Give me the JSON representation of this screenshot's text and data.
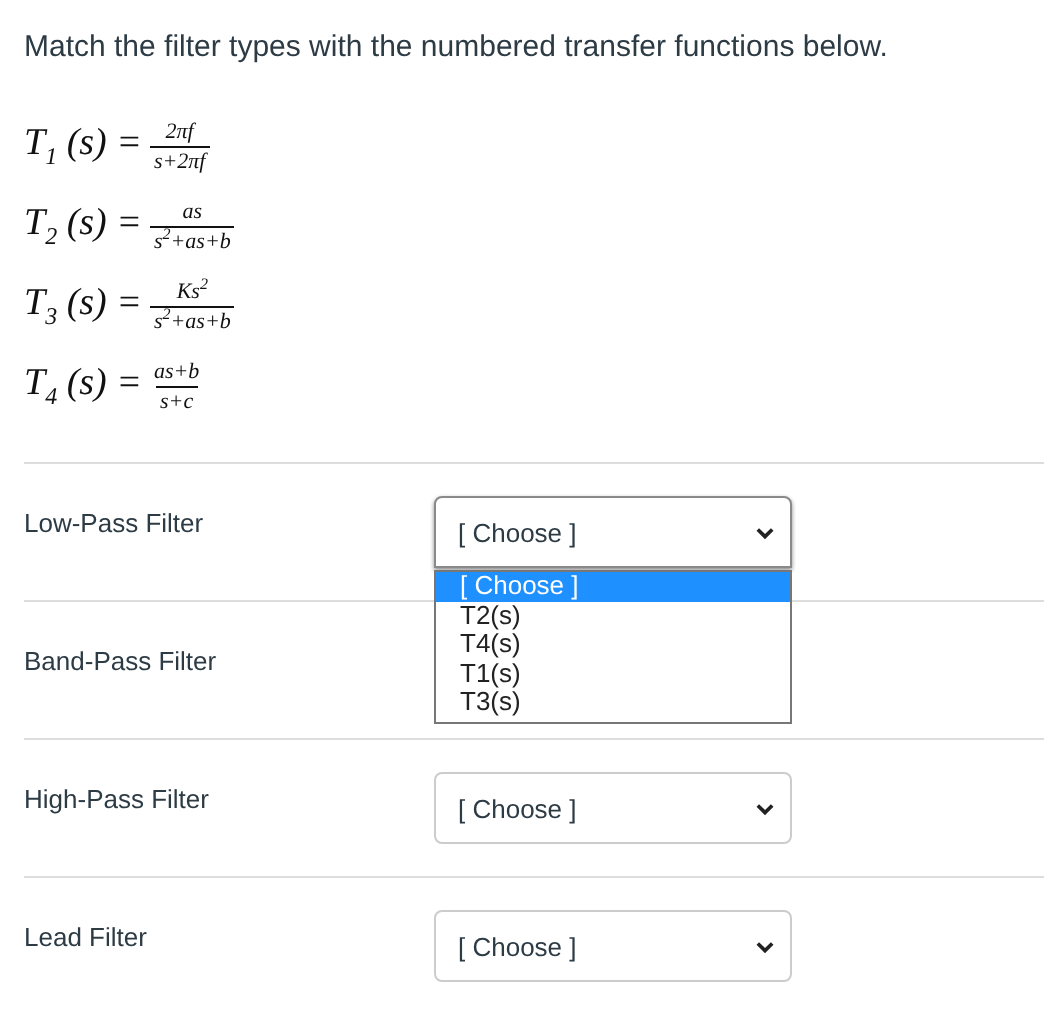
{
  "prompt": "Match the filter types with the numbered transfer functions below.",
  "formulas": [
    {
      "lhs": "T$_{1}$ (s) =",
      "numerator": "2πf",
      "denominator": "s+2πf"
    },
    {
      "lhs": "T$_{2}$ (s) =",
      "numerator": "as",
      "denominator": "s$^{2}$+as+b"
    },
    {
      "lhs": "T$_{3}$ (s) =",
      "numerator": "Ks$^{2}$",
      "denominator": "s$^{2}$+as+b"
    },
    {
      "lhs": "T$_{4}$ (s) =",
      "numerator": "as+b",
      "denominator": "s+c"
    }
  ],
  "matches": [
    {
      "label": "Low-Pass Filter",
      "select": {
        "value": "[ Choose ]",
        "expanded": true,
        "options": [
          {
            "label": "[ Choose ]",
            "selected": true
          },
          {
            "label": "T2(s)",
            "selected": false
          },
          {
            "label": "T4(s)",
            "selected": false
          },
          {
            "label": "T1(s)",
            "selected": false
          },
          {
            "label": "T3(s)",
            "selected": false
          }
        ]
      }
    },
    {
      "label": "Band-Pass Filter"
    },
    {
      "label": "High-Pass Filter",
      "select": {
        "value": "[ Choose ]",
        "expanded": false
      }
    },
    {
      "label": "Lead Filter",
      "select": {
        "value": "[ Choose ]",
        "expanded": false
      }
    }
  ]
}
